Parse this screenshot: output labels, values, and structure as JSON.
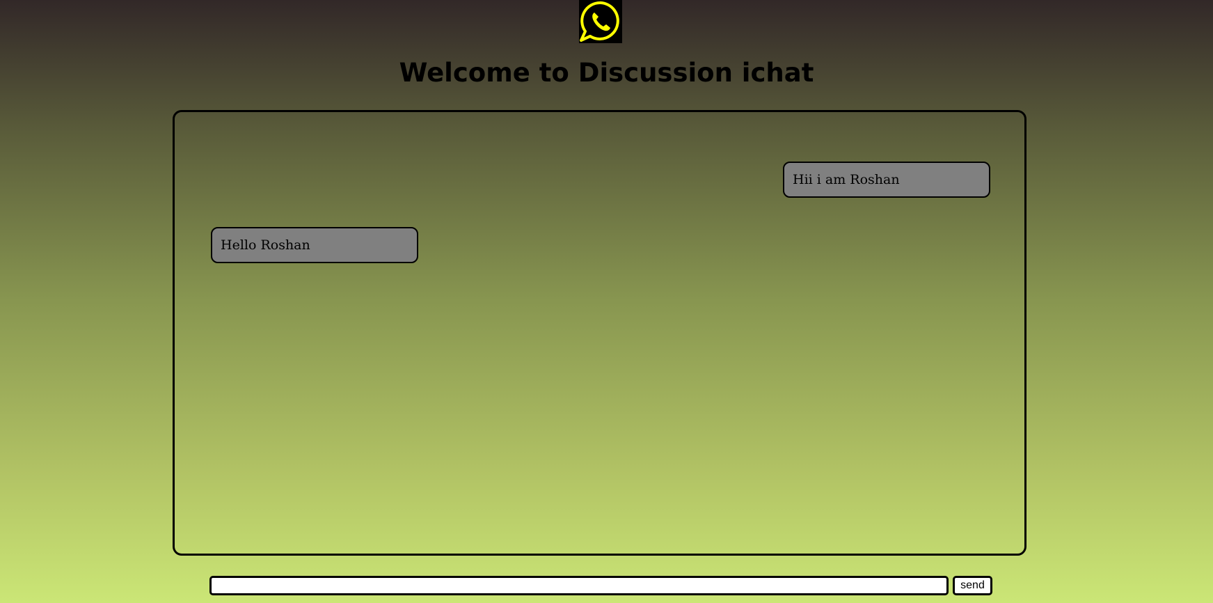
{
  "header": {
    "logo_icon": "whatsapp-icon",
    "logo_color": "#ffff00",
    "title": "Welcome to Discussion ichat"
  },
  "chat": {
    "messages": [
      {
        "side": "right",
        "text": "Hii i am Roshan"
      },
      {
        "side": "left",
        "text": "Hello Roshan"
      }
    ]
  },
  "composer": {
    "input_value": "",
    "send_label": "send"
  },
  "colors": {
    "message_bg": "#808080",
    "border": "#000000"
  }
}
